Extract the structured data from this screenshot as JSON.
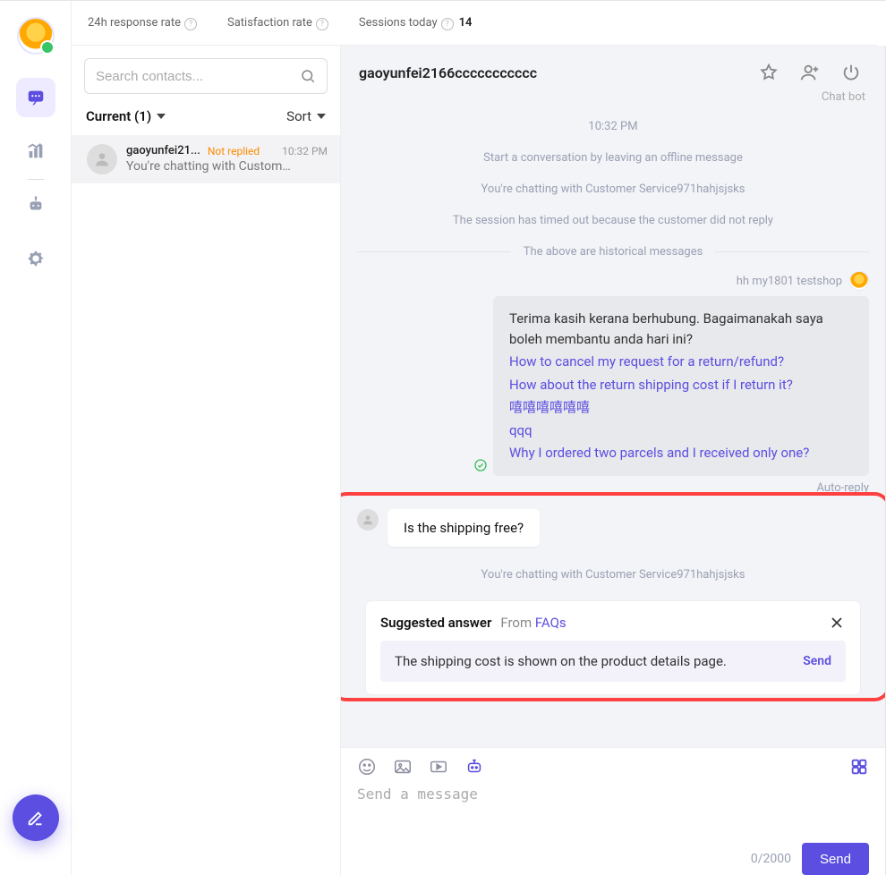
{
  "stats": {
    "response_rate_label": "24h response rate",
    "satisfaction_label": "Satisfaction rate",
    "sessions_label": "Sessions today",
    "sessions_count": "14"
  },
  "search": {
    "placeholder": "Search contacts..."
  },
  "list_header": {
    "current": "Current (1)",
    "sort": "Sort"
  },
  "conversation": {
    "name": "gaoyunfei21...",
    "tag": "Not replied",
    "time": "10:32 PM",
    "preview": "You're chatting with Custom…"
  },
  "chat": {
    "title": "gaoyunfei2166ccccccccccc",
    "chatbot_label": "Chat bot",
    "timestamp": "10:32 PM",
    "sys1": "Start a conversation by leaving an offline message",
    "sys2": "You're chatting with Customer Service971hahjsjsks",
    "sys3": "The session has timed out because the customer did not reply",
    "history_sep": "The above are historical messages",
    "sender_name": "hh my1801 testshop",
    "auto_reply_label": "Auto-reply",
    "bubble_text": "Terima kasih kerana berhubung. Bagaimanakah saya boleh membantu anda hari ini?",
    "links": [
      "How to cancel my request for a return/refund?",
      "How about the return shipping cost if I return it?",
      "嘻嘻嘻嘻嘻嘻",
      "qqq",
      "Why I ordered two parcels and I received only one?"
    ],
    "customer_msg": "Is the shipping free?",
    "sys4": "You're chatting with Customer Service971hahjsjsks"
  },
  "suggested": {
    "title": "Suggested answer",
    "from": "From ",
    "faq": "FAQs",
    "text": "The shipping cost is shown on the product details page.",
    "send": "Send"
  },
  "composer": {
    "placeholder": "Send a message",
    "counter": "0/2000",
    "send": "Send"
  }
}
